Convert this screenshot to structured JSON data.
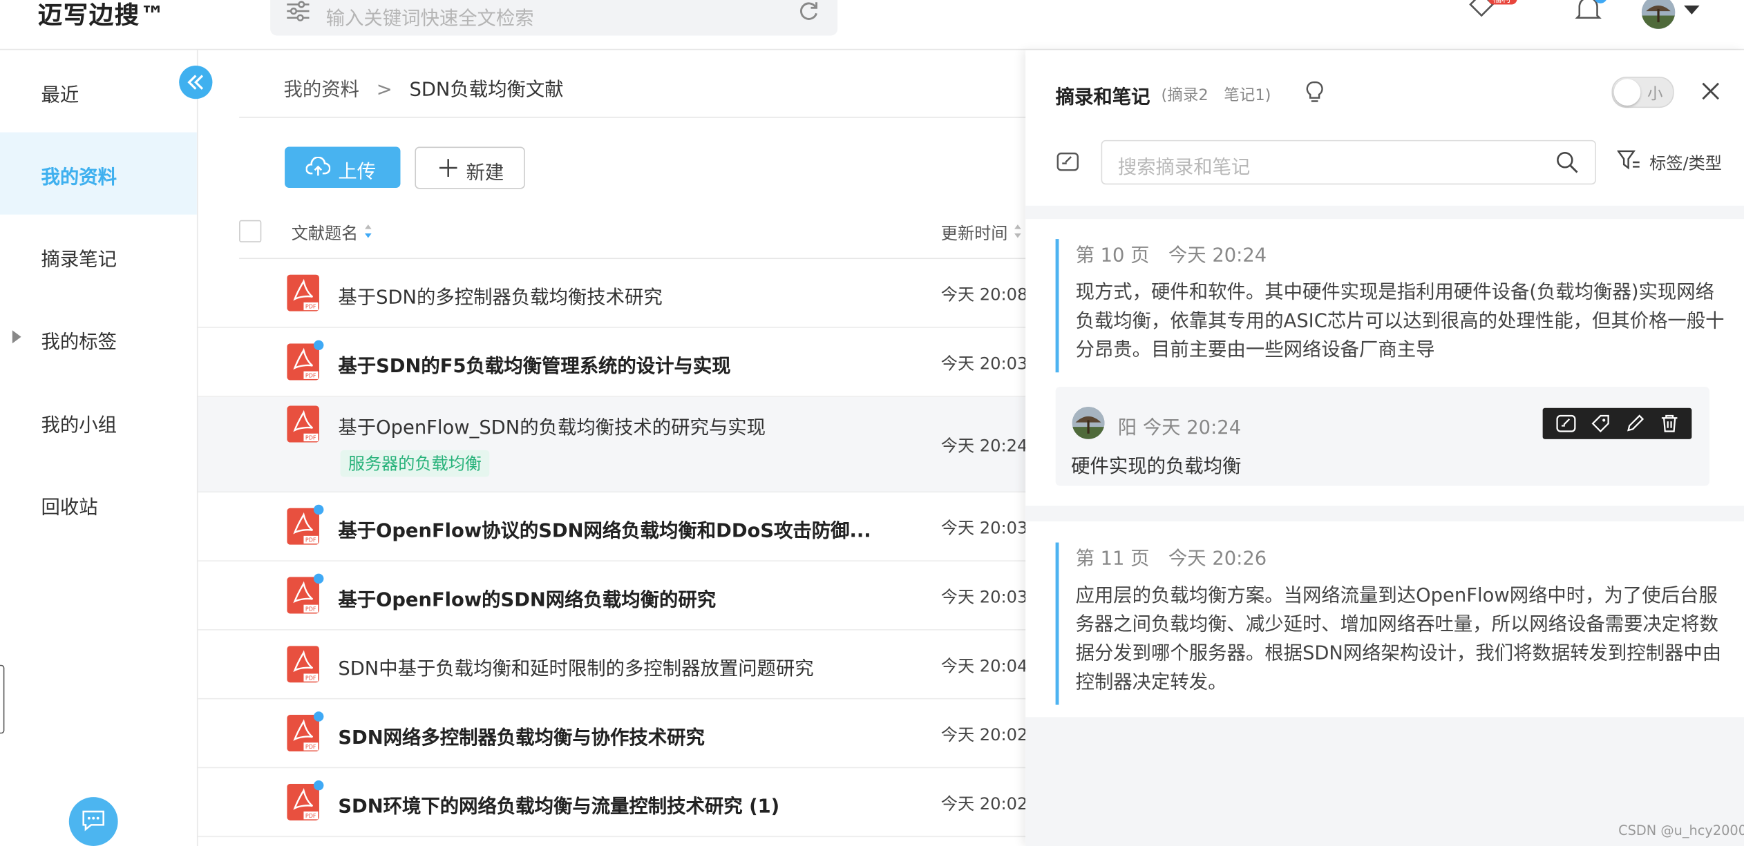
{
  "header": {
    "logo": "迈写边搜™",
    "search_placeholder": "输入关键词快速全文检索",
    "gift_badge": "福利",
    "bell_badge": "1"
  },
  "sidebar": {
    "items": [
      {
        "label": "最近"
      },
      {
        "label": "我的资料"
      },
      {
        "label": "摘录笔记"
      },
      {
        "label": "我的标签"
      },
      {
        "label": "我的小组"
      },
      {
        "label": "回收站"
      }
    ]
  },
  "main": {
    "breadcrumb": {
      "root": "我的资料",
      "sep": ">",
      "current": "SDN负载均衡文献"
    },
    "toolbar": {
      "upload_label": "上传",
      "new_label": "新建"
    },
    "columns": {
      "title": "文献题名",
      "updated": "更新时间"
    },
    "rows": [
      {
        "title": "基于SDN的多控制器负载均衡技术研究",
        "time": "今天 20:08"
      },
      {
        "title": "基于SDN的F5负载均衡管理系统的设计与实现",
        "time": "今天 20:03"
      },
      {
        "title": "基于OpenFlow_SDN的负载均衡技术的研究与实现",
        "time": "今天 20:24",
        "tag": "服务器的负载均衡"
      },
      {
        "title": "基于OpenFlow协议的SDN网络负载均衡和DDoS攻击防御...",
        "time": "今天 20:03"
      },
      {
        "title": "基于OpenFlow的SDN网络负载均衡的研究",
        "time": "今天 20:03"
      },
      {
        "title": "SDN中基于负载均衡和延时限制的多控制器放置问题研究",
        "time": "今天 20:04"
      },
      {
        "title": "SDN网络多控制器负载均衡与协作技术研究",
        "time": "今天 20:02"
      },
      {
        "title": "SDN环境下的网络负载均衡与流量控制技术研究 (1)",
        "time": "今天 20:02"
      }
    ]
  },
  "panel": {
    "title": "摘录和笔记",
    "count": "(摘录2　笔记1)",
    "toggle_label": "小",
    "search_placeholder": "搜索摘录和笔记",
    "filter_label": "标签/类型",
    "excerpts": [
      {
        "page": "第 10 页",
        "time": "今天 20:24",
        "text": "现方式，硬件和软件。其中硬件实现是指利用硬件设备(负载均衡器)实现网络负载均衡，依靠其专用的ASIC芯片可以达到很高的处理性能，但其价格一般十分昂贵。目前主要由一些网络设备厂商主导"
      },
      {
        "page": "第 11 页",
        "time": "今天 20:26",
        "text": "应用层的负载均衡方案。当网络流量到达OpenFlow网络中时，为了使后台服务器之间负载均衡、减少延时、增加网络吞吐量，所以网络设备需要决定将数据分发到哪个服务器。根据SDN网络架构设计，我们将数据转发到控制器中由控制器决定转发。"
      }
    ],
    "note": {
      "author": "阳",
      "time": "今天 20:24",
      "text": "硬件实现的负载均衡"
    }
  },
  "watermark": "CSDN @u_hcy2000"
}
